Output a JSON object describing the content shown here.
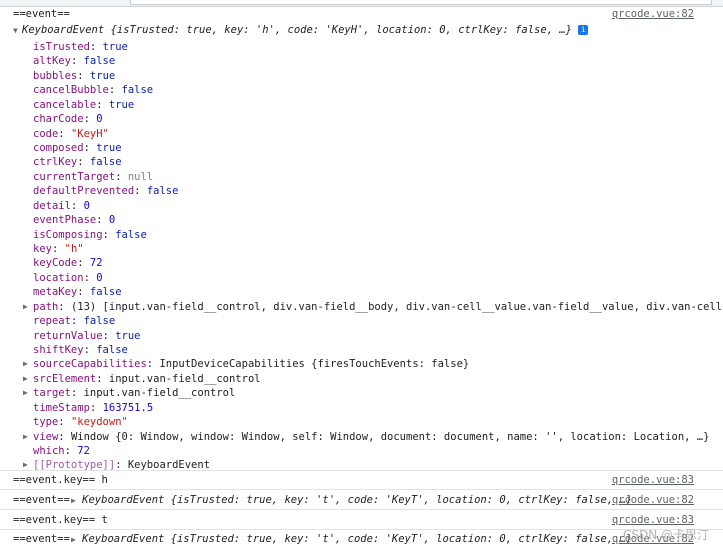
{
  "console_entries": [
    {
      "text": "==event==",
      "source": "qrcode.vue:82"
    },
    {
      "text": "==event.key== h",
      "source": "qrcode.vue:83"
    },
    {
      "text": "==event== ",
      "summary": "KeyboardEvent {isTrusted: true, key: 't', code: 'KeyT', location: 0, ctrlKey: false, …}",
      "source": "qrcode.vue:82"
    },
    {
      "text": "==event.key== t",
      "source": "qrcode.vue:83"
    },
    {
      "text": "==event== ",
      "summary": "KeyboardEvent {isTrusted: true, key: 't', code: 'KeyT', location: 0, ctrlKey: false, …}",
      "source": "qrcode.vue:82"
    }
  ],
  "object_summary": {
    "type": "KeyboardEvent",
    "preview": "{isTrusted: true, key: 'h', code: 'KeyH', location: 0, ctrlKey: false, …}",
    "info_glyph": "i"
  },
  "properties": [
    {
      "key": "isTrusted",
      "value": "true",
      "kind": "b"
    },
    {
      "key": "altKey",
      "value": "false",
      "kind": "b"
    },
    {
      "key": "bubbles",
      "value": "true",
      "kind": "b"
    },
    {
      "key": "cancelBubble",
      "value": "false",
      "kind": "b"
    },
    {
      "key": "cancelable",
      "value": "true",
      "kind": "b"
    },
    {
      "key": "charCode",
      "value": "0",
      "kind": "n"
    },
    {
      "key": "code",
      "value": "\"KeyH\"",
      "kind": "s"
    },
    {
      "key": "composed",
      "value": "true",
      "kind": "b"
    },
    {
      "key": "ctrlKey",
      "value": "false",
      "kind": "b"
    },
    {
      "key": "currentTarget",
      "value": "null",
      "kind": "nul"
    },
    {
      "key": "defaultPrevented",
      "value": "false",
      "kind": "b"
    },
    {
      "key": "detail",
      "value": "0",
      "kind": "n"
    },
    {
      "key": "eventPhase",
      "value": "0",
      "kind": "n"
    },
    {
      "key": "isComposing",
      "value": "false",
      "kind": "b"
    },
    {
      "key": "key",
      "value": "\"h\"",
      "kind": "s"
    },
    {
      "key": "keyCode",
      "value": "72",
      "kind": "n"
    },
    {
      "key": "location",
      "value": "0",
      "kind": "n"
    },
    {
      "key": "metaKey",
      "value": "false",
      "kind": "b"
    },
    {
      "key": "path",
      "value": "(13) [input.van-field__control, div.van-field__body, div.van-cell__value.van-field__value, div.van-cell.van",
      "kind": "o",
      "expandable": true
    },
    {
      "key": "repeat",
      "value": "false",
      "kind": "b"
    },
    {
      "key": "returnValue",
      "value": "true",
      "kind": "b"
    },
    {
      "key": "shiftKey",
      "value": "false",
      "kind": "b"
    },
    {
      "key": "sourceCapabilities",
      "value": "InputDeviceCapabilities {firesTouchEvents: false}",
      "kind": "o",
      "expandable": true
    },
    {
      "key": "srcElement",
      "value": "input.van-field__control",
      "kind": "o",
      "expandable": true
    },
    {
      "key": "target",
      "value": "input.van-field__control",
      "kind": "o",
      "expandable": true
    },
    {
      "key": "timeStamp",
      "value": "163751.5",
      "kind": "n"
    },
    {
      "key": "type",
      "value": "\"keydown\"",
      "kind": "s"
    },
    {
      "key": "view",
      "value": "Window {0: Window, window: Window, self: Window, document: document, name: '', location: Location, …}",
      "kind": "o",
      "expandable": true
    },
    {
      "key": "which",
      "value": "72",
      "kind": "n"
    },
    {
      "key": "[[Prototype]]",
      "value": "KeyboardEvent",
      "kind": "o",
      "expandable": true,
      "internal": true
    }
  ],
  "watermark": "CSDN @卡思汀"
}
